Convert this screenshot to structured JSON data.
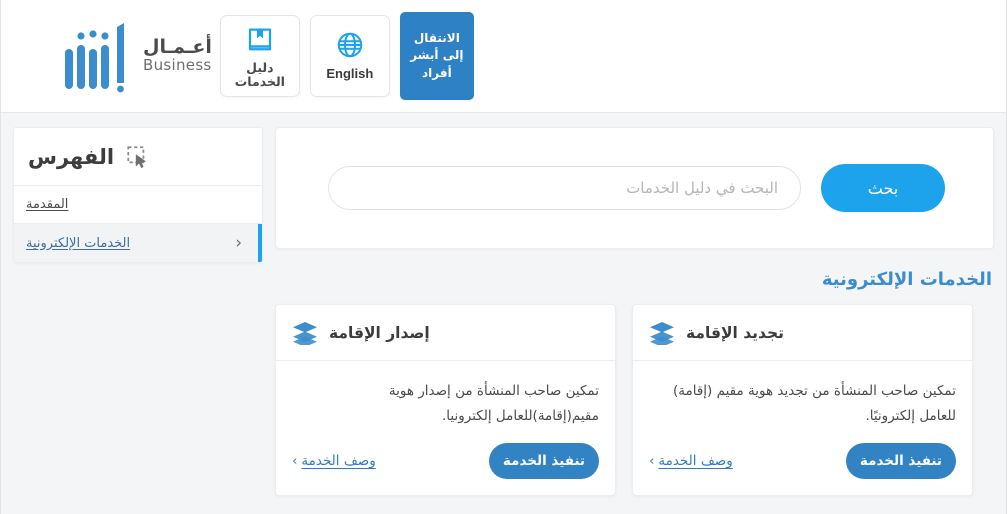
{
  "header": {
    "brand": {
      "logo_icon": "absher-logo-icon",
      "arabic": "أعـمـال",
      "english": "Business"
    },
    "actions": [
      {
        "id": "services-guide",
        "label": "دليل الخدمات",
        "icon": "book-bookmark-icon",
        "style": "outline"
      },
      {
        "id": "english",
        "label": "English",
        "icon": "globe-icon",
        "style": "outline"
      },
      {
        "id": "go-to-absher-individuals",
        "label": "الانتقال إلى أبشر أفراد",
        "icon": "",
        "style": "primary"
      }
    ]
  },
  "sidebar": {
    "title": "الفهرس",
    "title_icon": "cursor-select-icon",
    "items": [
      {
        "label": "المقدمة",
        "active": false,
        "chevron": ""
      },
      {
        "label": "الخدمات الإلكترونية",
        "active": true,
        "chevron": "‹"
      }
    ]
  },
  "search": {
    "placeholder": "البحث في دليل الخدمات",
    "value": "",
    "button_label": "بحث"
  },
  "main": {
    "section_title": "الخدمات الإلكترونية",
    "cards": [
      {
        "title": "إصدار الإقامة",
        "icon": "layers-icon",
        "description": "تمكين صاحب المنشأة من إصدار هوية مقيم(إقامة)للعامل إلكترونيا.",
        "link_label": "وصف الخدمة",
        "link_chevron": "›",
        "button_label": "تنفيذ الخدمة"
      },
      {
        "title": "تجديد الإقامة",
        "icon": "layers-icon",
        "description": "تمكين صاحب المنشأة من تجديد هوية مقيم (إقامة) للعامل إلكترونيًا.",
        "link_label": "وصف الخدمة",
        "link_chevron": "›",
        "button_label": "تنفيذ الخدمة"
      }
    ]
  },
  "colors": {
    "brand_blue": "#2e81c4",
    "accent_cyan": "#1ca3ec",
    "button_blue": "#3283c4",
    "section_title": "#3c8dcd",
    "page_bg": "#f4f5f7"
  }
}
